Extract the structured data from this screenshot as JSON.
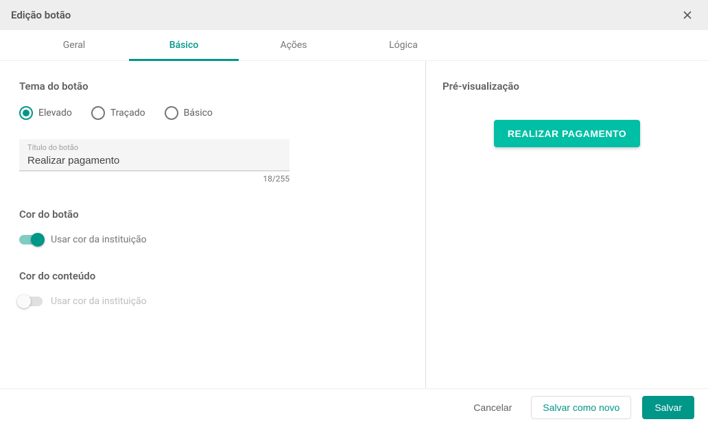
{
  "dialog": {
    "title": "Edição botão"
  },
  "tabs": {
    "geral": "Geral",
    "basico": "Básico",
    "acoes": "Ações",
    "logica": "Lógica"
  },
  "theme": {
    "section_title": "Tema do botão",
    "options": {
      "elevado": "Elevado",
      "tracado": "Traçado",
      "basico": "Básico"
    }
  },
  "title_field": {
    "label": "Título do botão",
    "value": "Realizar pagamento",
    "counter": "18/255"
  },
  "button_color": {
    "section_title": "Cor do botão",
    "toggle_label": "Usar cor da instituição"
  },
  "content_color": {
    "section_title": "Cor do conteúdo",
    "toggle_label": "Usar cor da instituição"
  },
  "preview": {
    "title": "Pré-visualização",
    "button_label": "REALIZAR PAGAMENTO"
  },
  "footer": {
    "cancel": "Cancelar",
    "save_as_new": "Salvar como novo",
    "save": "Salvar"
  }
}
